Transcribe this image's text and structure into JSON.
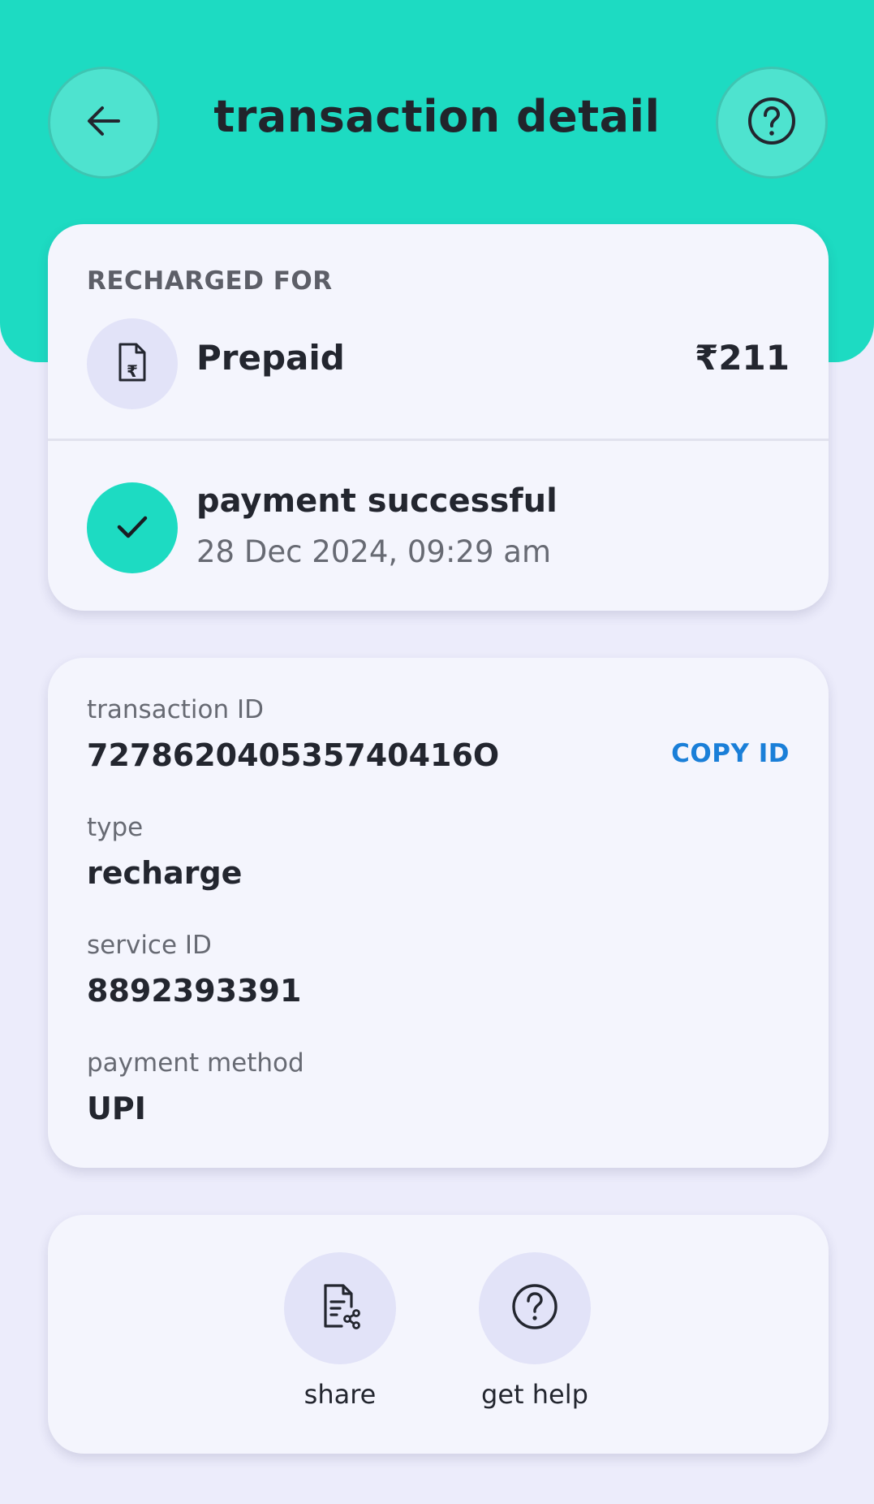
{
  "header": {
    "title": "transaction detail",
    "back_icon": "arrow-left-icon",
    "help_icon": "question-circle-icon",
    "bg_color": "#1ddbc2"
  },
  "summary": {
    "recharged_for_label": "RECHARGED FOR",
    "plan_icon": "rupee-document-icon",
    "plan_name": "Prepaid",
    "amount": "₹211",
    "status_icon": "check-icon",
    "status_text": "payment successful",
    "timestamp": "28 Dec 2024, 09:29 am"
  },
  "details": {
    "transaction_id_label": "transaction ID",
    "transaction_id": "727862040535740416O",
    "copy_label": "COPY ID",
    "type_label": "type",
    "type_value": "recharge",
    "service_id_label": "service ID",
    "service_id": "8892393391",
    "payment_method_label": "payment method",
    "payment_method": "UPI"
  },
  "actions": [
    {
      "label": "share",
      "icon": "share-document-icon"
    },
    {
      "label": "get help",
      "icon": "question-circle-icon"
    }
  ],
  "colors": {
    "accent": "#1ddbc2",
    "link": "#1a7fd8",
    "page_bg": "#ececfb",
    "card_bg": "#f4f5fd"
  }
}
